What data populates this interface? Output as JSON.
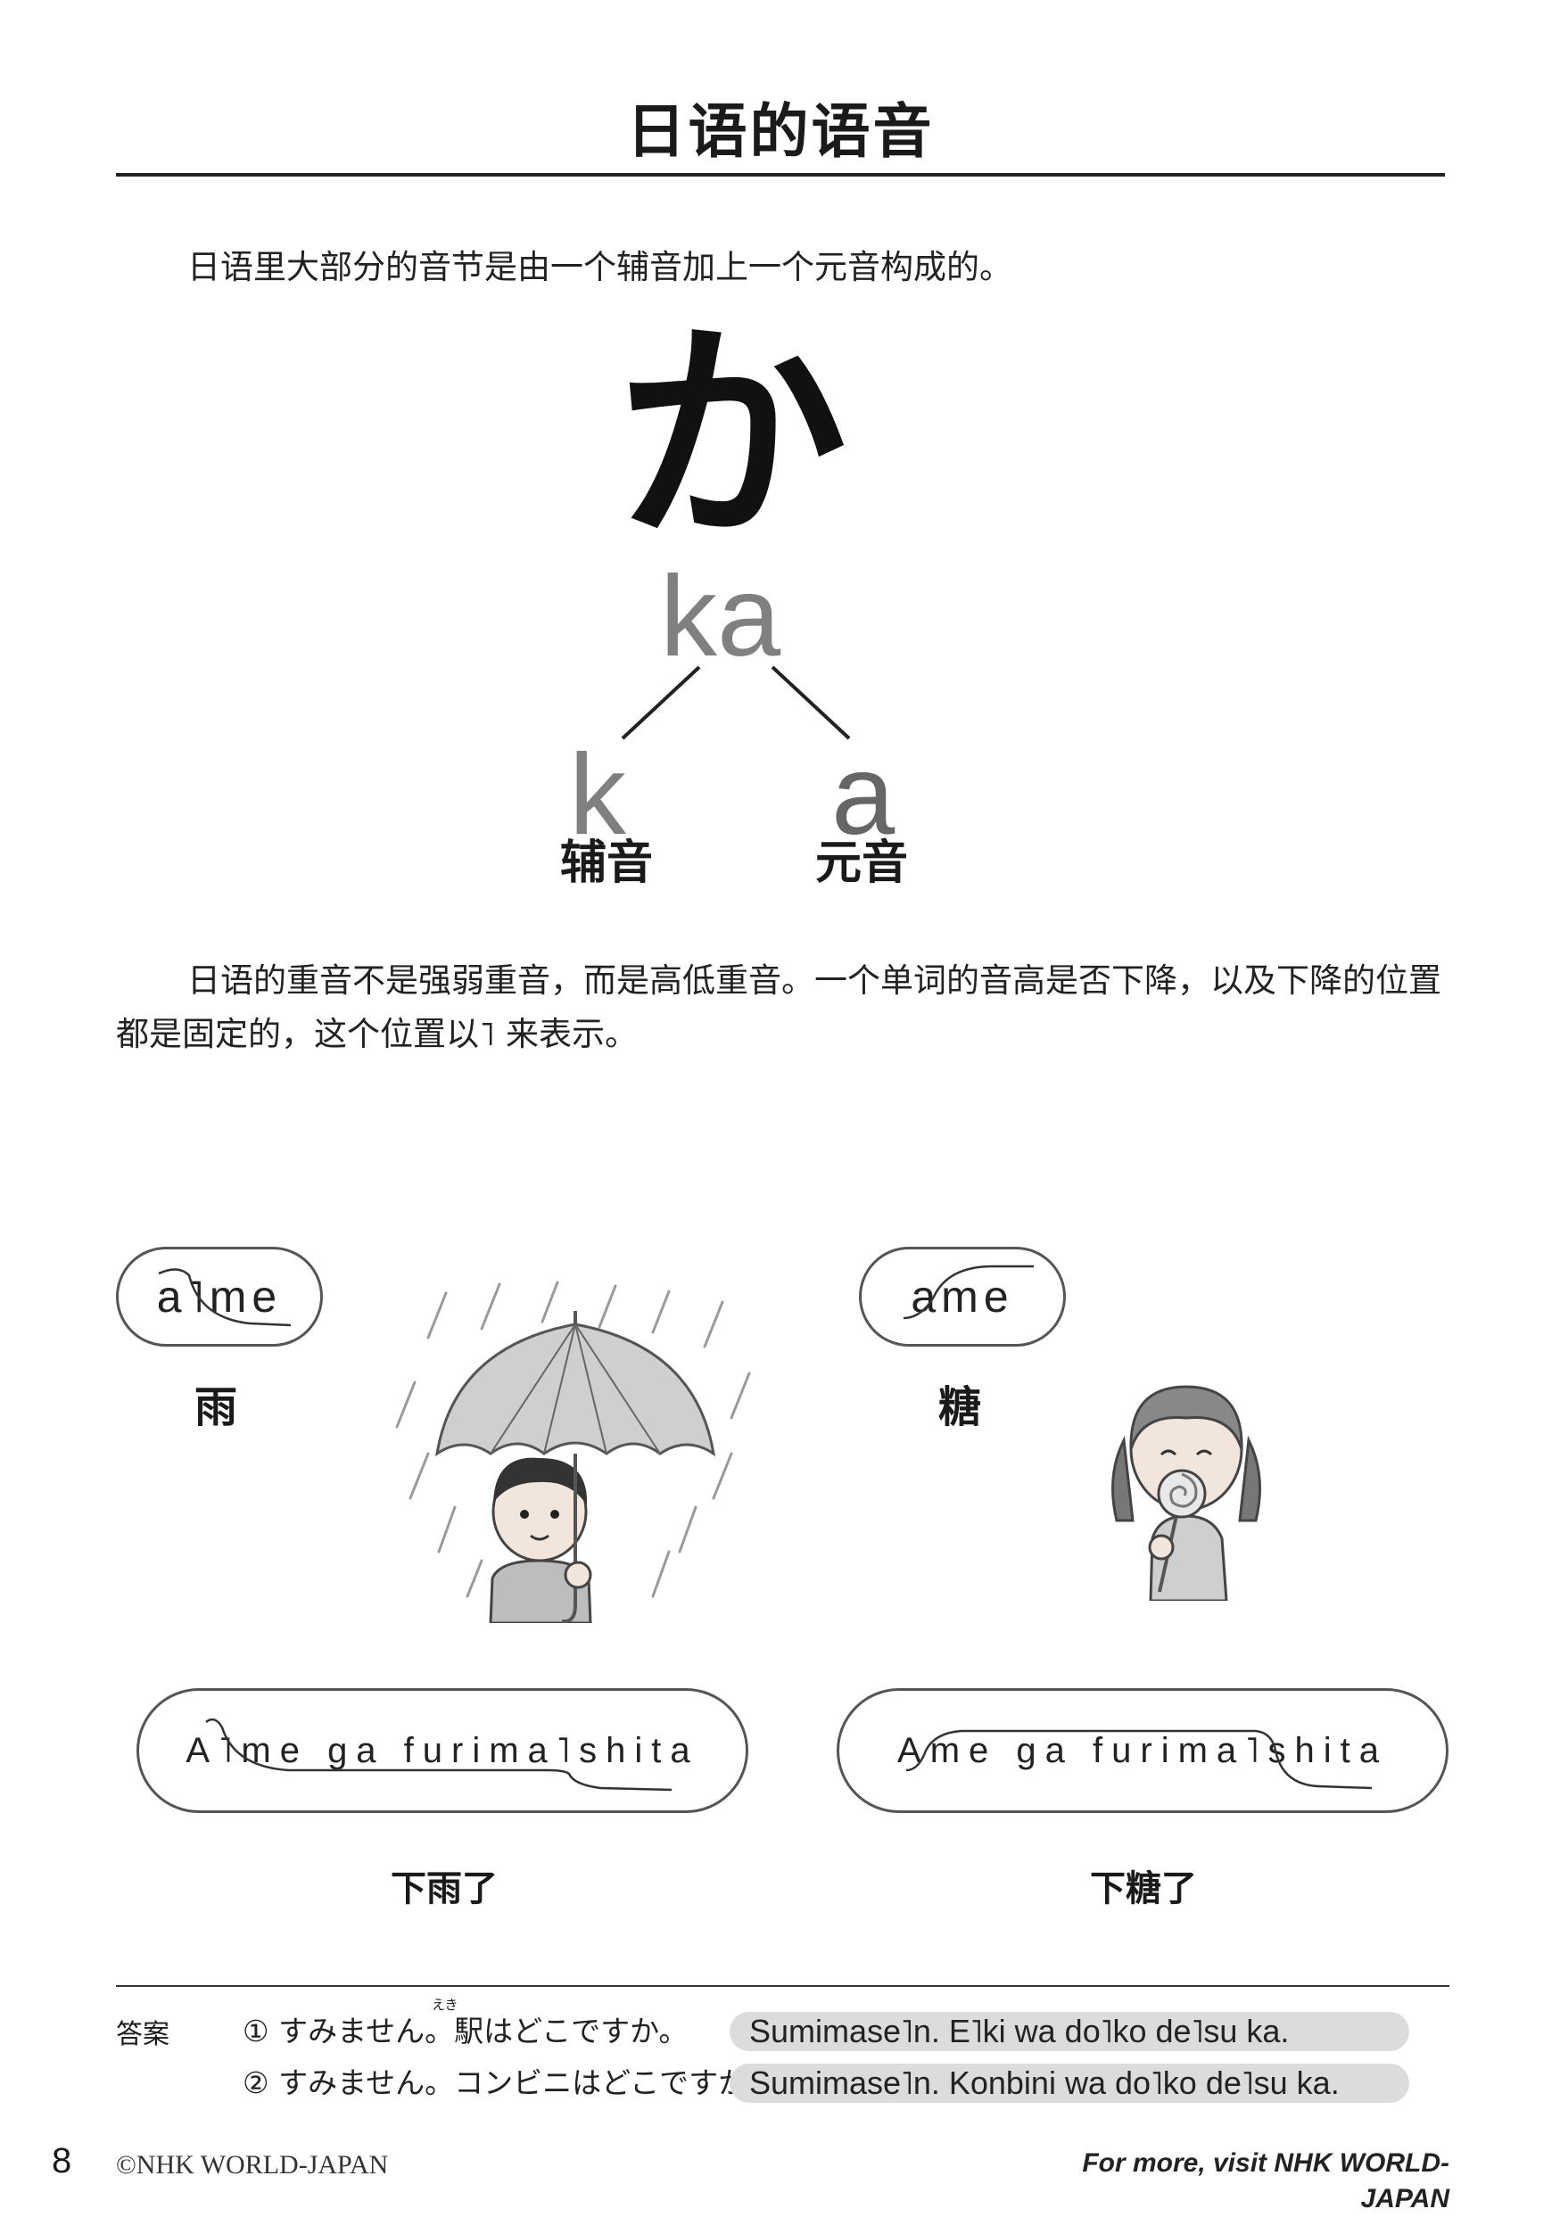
{
  "title": "日语的语音",
  "intro_text": "日语里大部分的音节是由一个辅音加上一个元音构成的。",
  "diagram": {
    "kana": "か",
    "syllable": "ka",
    "consonant": "k",
    "vowel": "a",
    "consonant_label": "辅音",
    "vowel_label": "元音"
  },
  "accent_text": "日语的重音不是强弱重音，而是高低重音。一个单词的音高是否下降，以及下降的位置都是固定的，这个位置以˥ 来表示。",
  "examples": [
    {
      "word_romaji": "a˥me",
      "word_meaning": "雨",
      "sentence_romaji": "A˥me ga furima˥shita",
      "sentence_meaning": "下雨了",
      "illustration": "boy-with-umbrella-in-rain"
    },
    {
      "word_romaji": "ame",
      "word_meaning": "糖",
      "sentence_romaji": "Ame ga furima˥shita",
      "sentence_meaning": "下糖了",
      "illustration": "girl-with-lollipop"
    }
  ],
  "answers": {
    "label": "答案",
    "items": [
      {
        "jp": "① すみません。駅はどこですか。",
        "furigana": "えき",
        "romaji": "Sumimase˥n. E˥ki wa do˥ko de˥su ka."
      },
      {
        "jp": "② すみません。コンビニはどこですか。",
        "romaji": "Sumimase˥n. Konbini wa do˥ko de˥su ka."
      }
    ]
  },
  "footer": {
    "page_number": "8",
    "copyright": "©NHK WORLD-JAPAN",
    "more": "For more, visit NHK WORLD-JAPAN"
  }
}
